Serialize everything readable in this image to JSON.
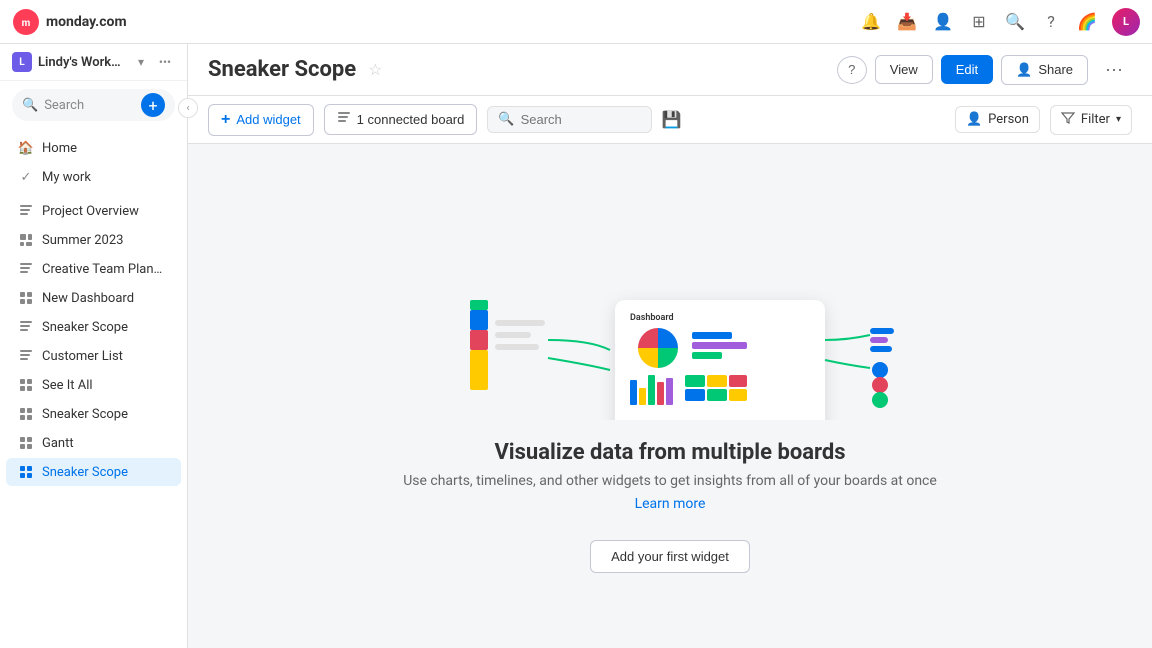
{
  "topbar": {
    "logo_text": "monday.com",
    "icons": [
      "bell",
      "inbox",
      "people",
      "apps",
      "search",
      "help",
      "rainbow"
    ]
  },
  "sidebar": {
    "workspace_name": "Lindy's Worksp...",
    "workspace_badge": "L",
    "search_placeholder": "Search",
    "add_tooltip": "Add",
    "nav_items": [
      {
        "id": "home",
        "label": "Home",
        "icon": "home",
        "active": false
      },
      {
        "id": "my-work",
        "label": "My work",
        "icon": "check",
        "active": false
      }
    ],
    "board_items": [
      {
        "id": "project-overview",
        "label": "Project Overview",
        "icon": "board",
        "active": false
      },
      {
        "id": "summer-2023",
        "label": "Summer 2023",
        "icon": "dashboard",
        "active": false
      },
      {
        "id": "creative-team-planning",
        "label": "Creative Team Planning",
        "icon": "board",
        "active": false
      },
      {
        "id": "new-dashboard",
        "label": "New Dashboard",
        "icon": "grid",
        "active": false
      },
      {
        "id": "sneaker-scope-1",
        "label": "Sneaker Scope",
        "icon": "board",
        "active": false
      },
      {
        "id": "customer-list",
        "label": "Customer List",
        "icon": "board",
        "active": false
      },
      {
        "id": "see-it-all",
        "label": "See It All",
        "icon": "grid",
        "active": false
      },
      {
        "id": "sneaker-scope-2",
        "label": "Sneaker Scope",
        "icon": "grid",
        "active": false
      },
      {
        "id": "gantt",
        "label": "Gantt",
        "icon": "grid",
        "active": false
      },
      {
        "id": "sneaker-scope-3",
        "label": "Sneaker Scope",
        "icon": "grid",
        "active": true
      }
    ]
  },
  "page": {
    "title": "Sneaker Scope",
    "view_label": "View",
    "edit_label": "Edit",
    "share_label": "Share",
    "more_label": "..."
  },
  "toolbar": {
    "add_widget_label": "Add widget",
    "connected_board_label": "1 connected board",
    "search_placeholder": "Search",
    "person_label": "Person",
    "filter_label": "Filter"
  },
  "empty_state": {
    "title": "Visualize data from multiple boards",
    "description": "Use charts, timelines, and other widgets to get insights from all of your boards at once",
    "learn_more": "Learn more",
    "add_button": "Add your first widget"
  },
  "illustration": {
    "colors": {
      "blue": "#0073ea",
      "green": "#00c875",
      "yellow": "#ffcb00",
      "red": "#e2445c",
      "purple": "#a25ddc",
      "orange": "#ff7575",
      "teal": "#00d6ac",
      "connector": "#00c875"
    }
  }
}
